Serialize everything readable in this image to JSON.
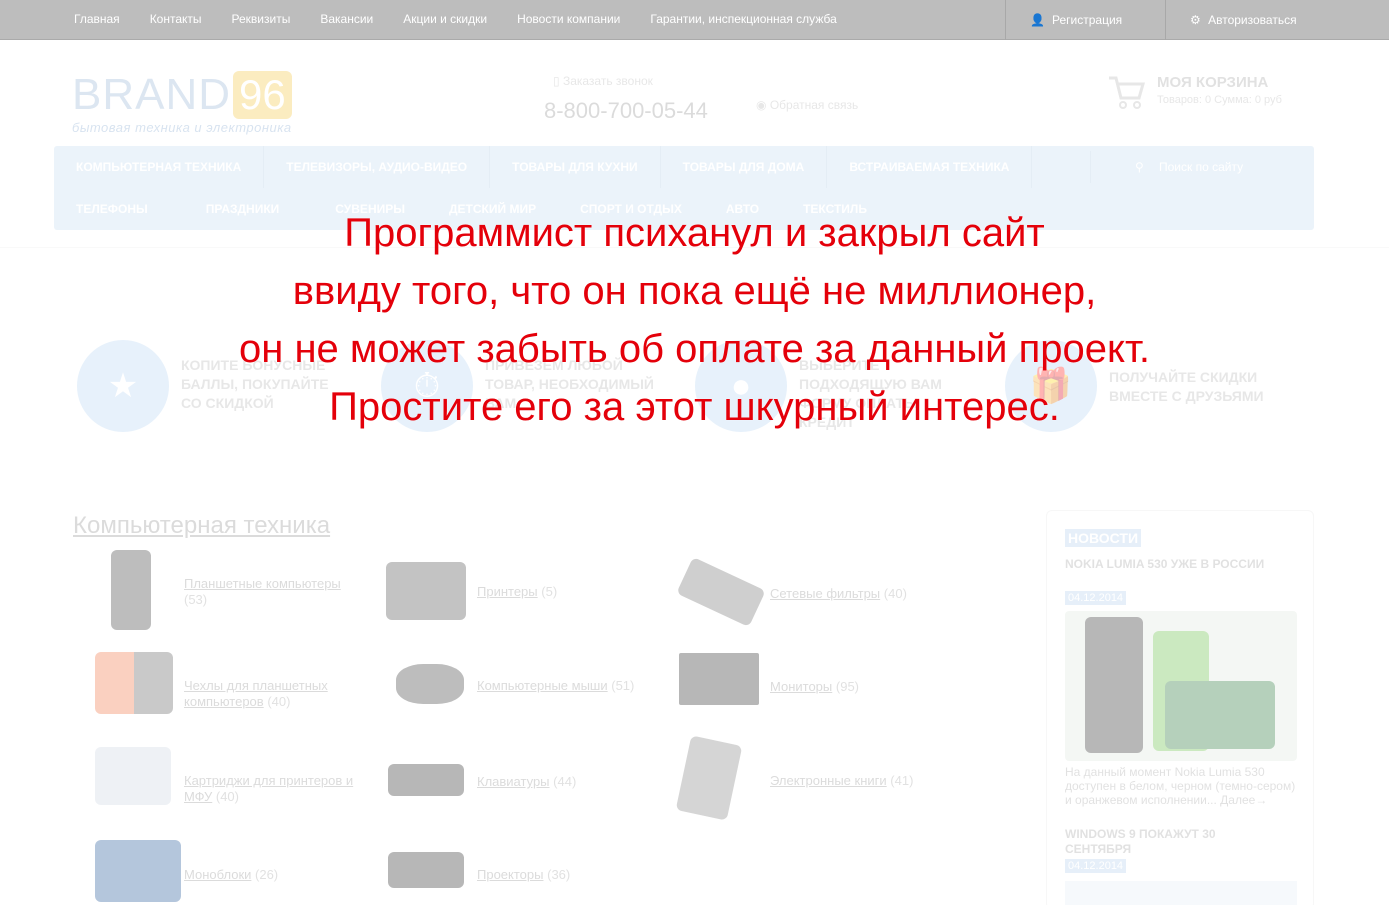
{
  "topbar": {
    "links": [
      "Главная",
      "Контакты",
      "Реквизиты",
      "Вакансии",
      "Акции и скидки",
      "Новости компании",
      "Гарантии, инспекционная служба"
    ],
    "register": "Регистрация",
    "login": "Авторизоваться"
  },
  "header": {
    "logo_brand": "BRAND",
    "logo_number": "96",
    "logo_tagline": "бытовая техника и электроника",
    "callback": "Заказать звонок",
    "phone": "8-800-700-05-44",
    "feedback": "Обратная связь",
    "cart_title": "МОЯ КОРЗИНА",
    "cart_summary": "Товаров: 0   Сумма: 0 руб"
  },
  "nav": {
    "row1": [
      "КОМПЬЮТЕРНАЯ ТЕХНИКА",
      "ТЕЛЕВИЗОРЫ, АУДИО-ВИДЕО",
      "ТОВАРЫ ДЛЯ КУХНИ",
      "ТОВАРЫ ДЛЯ ДОМА",
      "ВСТРАИВАЕМАЯ ТЕХНИКА"
    ],
    "row2": [
      "ТЕЛЕФОНЫ",
      "ПРАЗДНИКИ",
      "СУВЕНИРЫ",
      "ДЕТСКИЙ МИР",
      "СПОРТ И ОТДЫХ",
      "АВТО",
      "ТЕКСТИЛЬ"
    ],
    "search_placeholder": "Поиск по сайту"
  },
  "features": [
    {
      "text": "КОПИТЕ БОНУСНЫЕ БАЛЛЫ, ПОКУПАЙТЕ СО СКИДКОЙ"
    },
    {
      "text": "ПРИВЕЗЕМ ЛЮБОЙ ТОВАР, НЕОБХОДИМЫЙ ВАМ"
    },
    {
      "text": "ВЫБЕРИТЕ ПОДХОДЯЩУЮ ВАМ ФОРМУ ОПЛАТЫ КРЕДИТ"
    },
    {
      "text": "ПОЛУЧАЙТЕ СКИДКИ ВМЕСТЕ С ДРУЗЬЯМИ"
    }
  ],
  "category": {
    "title": "Компьютерная техника",
    "items": [
      {
        "name": "Планшетные компьютеры",
        "count": "(53)"
      },
      {
        "name": "Принтеры",
        "count": "(5)"
      },
      {
        "name": "Сетевые фильтры",
        "count": "(40)"
      },
      {
        "name": "Чехлы для планшетных компьютеров",
        "count": "(40)"
      },
      {
        "name": "Компьютерные мыши",
        "count": "(51)"
      },
      {
        "name": "Мониторы",
        "count": "(95)"
      },
      {
        "name": "Картриджи для принтеров и МФУ",
        "count": "(40)"
      },
      {
        "name": "Клавиатуры",
        "count": "(44)"
      },
      {
        "name": "Электронные книги",
        "count": "(41)"
      },
      {
        "name": "Моноблоки",
        "count": "(26)"
      },
      {
        "name": "Проекторы",
        "count": "(36)"
      }
    ]
  },
  "news": {
    "heading": "НОВОСТИ",
    "item1_title": "NOKIA LUMIA 530 УЖЕ В РОССИИ",
    "item1_date": "04.12.2014",
    "item1_text": "На данный момент Nokia Lumia 530 доступен в белом, черном (темно-сером) и оранжевом исполнении... Далее→",
    "item2_title": "WINDOWS 9 ПОКАЖУТ 30 СЕНТЯБРЯ",
    "item2_date": "04.12.2014"
  },
  "overlay": {
    "line1": "Программист психанул и закрыл сайт",
    "line2": "ввиду того, что он пока ещё не миллионер,",
    "line3": "он не может забыть об оплате за данный проект.",
    "line4": "Простите его за этот шкурный интерес."
  }
}
